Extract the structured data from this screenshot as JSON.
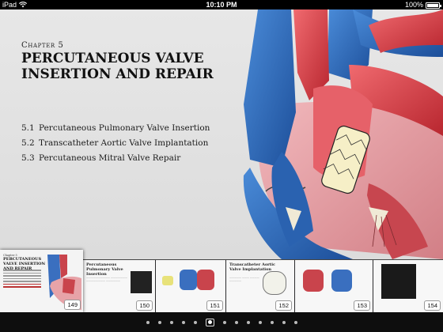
{
  "status_bar": {
    "device": "iPad",
    "time": "10:10 PM",
    "battery_percent": "100%",
    "battery_level": 1.0
  },
  "chapter": {
    "label": "Chapter 5",
    "title": "PERCUTANEOUS VALVE INSERTION AND REPAIR",
    "toc": [
      {
        "num": "5.1",
        "title": "Percutaneous Pulmonary Valve Insertion"
      },
      {
        "num": "5.2",
        "title": "Transcatheter Aortic Valve Implantation"
      },
      {
        "num": "5.3",
        "title": "Percutaneous Mitral Valve Repair"
      }
    ]
  },
  "thumbnails": {
    "first": {
      "chapter": "Chapter 5",
      "title": "PERCUTANEOUS VALVE INSERTION AND REPAIR",
      "page": "149"
    },
    "pages": [
      {
        "page": "150",
        "title": "Percutaneous Pulmonary Valve Insertion"
      },
      {
        "page": "151",
        "title": ""
      },
      {
        "page": "152",
        "title": "Transcatheter Aortic Valve Implantation"
      },
      {
        "page": "153",
        "title": ""
      },
      {
        "page": "154",
        "title": ""
      }
    ]
  },
  "pager": {
    "dot_count": 13,
    "active_index": 5
  },
  "colors": {
    "artery_red": "#d9414a",
    "vein_blue": "#2f6fbf",
    "muscle_pink": "#e7a3a8",
    "strip_bg": "#2c2c2e"
  },
  "icons": {
    "wifi": "wifi-icon",
    "battery": "battery-icon",
    "illustration": "heart-valve-illustration"
  }
}
